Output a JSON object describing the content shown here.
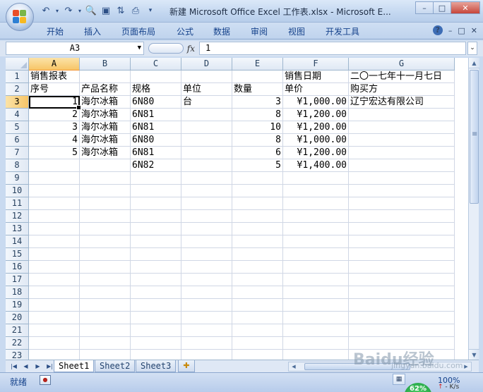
{
  "window": {
    "title": "新建 Microsoft Office Excel 工作表.xlsx - Microsoft E...",
    "controls": [
      "–",
      "□",
      "✕"
    ]
  },
  "qat": {
    "icons": [
      "save-icon",
      "undo-icon",
      "redo-icon",
      "print-preview-icon",
      "sort-icon",
      "print-icon",
      "customize-icon"
    ]
  },
  "ribbon": {
    "tabs": [
      "开始",
      "插入",
      "页面布局",
      "公式",
      "数据",
      "审阅",
      "视图",
      "开发工具"
    ],
    "right_icons": [
      "?",
      "–",
      "□",
      "✕"
    ]
  },
  "formula_bar": {
    "name_box": "A3",
    "fx_label": "fx",
    "formula": "1"
  },
  "columns": [
    "A",
    "B",
    "C",
    "D",
    "E",
    "F",
    "G"
  ],
  "active_column": "A",
  "active_row": "3",
  "rows": [
    {
      "num": "1",
      "cells": [
        "销售报表",
        "",
        "",
        "",
        "",
        "销售日期",
        "二〇一七年十一月七日"
      ]
    },
    {
      "num": "2",
      "cells": [
        "序号",
        "产品名称",
        "规格",
        "单位",
        "数量",
        "单价",
        "购买方"
      ]
    },
    {
      "num": "3",
      "cells": [
        "1",
        "海尔冰箱",
        "6N80",
        "台",
        "3",
        "¥1,000.00",
        "辽宁宏达有限公司"
      ]
    },
    {
      "num": "4",
      "cells": [
        "2",
        "海尔冰箱",
        "6N81",
        "",
        "8",
        "¥1,200.00",
        ""
      ]
    },
    {
      "num": "5",
      "cells": [
        "3",
        "海尔冰箱",
        "6N81",
        "",
        "10",
        "¥1,200.00",
        ""
      ]
    },
    {
      "num": "6",
      "cells": [
        "4",
        "海尔冰箱",
        "6N80",
        "",
        "8",
        "¥1,000.00",
        ""
      ]
    },
    {
      "num": "7",
      "cells": [
        "5",
        "海尔冰箱",
        "6N81",
        "",
        "6",
        "¥1,200.00",
        ""
      ]
    },
    {
      "num": "8",
      "cells": [
        "",
        "",
        "6N82",
        "",
        "5",
        "¥1,400.00",
        ""
      ]
    },
    {
      "num": "9",
      "cells": [
        "",
        "",
        "",
        "",
        "",
        "",
        ""
      ]
    },
    {
      "num": "10",
      "cells": [
        "",
        "",
        "",
        "",
        "",
        "",
        ""
      ]
    },
    {
      "num": "11",
      "cells": [
        "",
        "",
        "",
        "",
        "",
        "",
        ""
      ]
    },
    {
      "num": "12",
      "cells": [
        "",
        "",
        "",
        "",
        "",
        "",
        ""
      ]
    },
    {
      "num": "13",
      "cells": [
        "",
        "",
        "",
        "",
        "",
        "",
        ""
      ]
    },
    {
      "num": "14",
      "cells": [
        "",
        "",
        "",
        "",
        "",
        "",
        ""
      ]
    },
    {
      "num": "15",
      "cells": [
        "",
        "",
        "",
        "",
        "",
        "",
        ""
      ]
    },
    {
      "num": "16",
      "cells": [
        "",
        "",
        "",
        "",
        "",
        "",
        ""
      ]
    },
    {
      "num": "17",
      "cells": [
        "",
        "",
        "",
        "",
        "",
        "",
        ""
      ]
    },
    {
      "num": "18",
      "cells": [
        "",
        "",
        "",
        "",
        "",
        "",
        ""
      ]
    },
    {
      "num": "19",
      "cells": [
        "",
        "",
        "",
        "",
        "",
        "",
        ""
      ]
    },
    {
      "num": "20",
      "cells": [
        "",
        "",
        "",
        "",
        "",
        "",
        ""
      ]
    },
    {
      "num": "21",
      "cells": [
        "",
        "",
        "",
        "",
        "",
        "",
        ""
      ]
    },
    {
      "num": "22",
      "cells": [
        "",
        "",
        "",
        "",
        "",
        "",
        ""
      ]
    },
    {
      "num": "23",
      "cells": [
        "",
        "",
        "",
        "",
        "",
        "",
        ""
      ]
    }
  ],
  "sheets": {
    "tabs": [
      "Sheet1",
      "Sheet2",
      "Sheet3"
    ],
    "active": "Sheet1"
  },
  "status": {
    "ready": "就绪",
    "zoom": "100%",
    "net_percent": "62%",
    "net_speed": "- K/s"
  },
  "watermark": {
    "text": "Baidu经验",
    "sub": "jingyan.baidu.com"
  }
}
